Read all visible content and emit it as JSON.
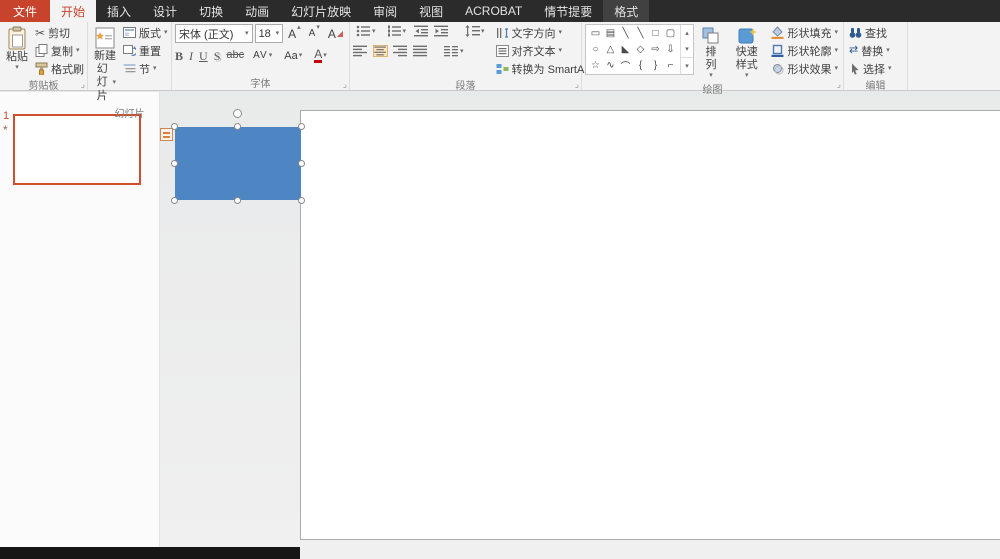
{
  "tabs": {
    "file": "文件",
    "list": [
      "开始",
      "插入",
      "设计",
      "切换",
      "动画",
      "幻灯片放映",
      "审阅",
      "视图",
      "ACROBAT",
      "情节提要",
      "格式"
    ]
  },
  "icons": {
    "caret": "▾",
    "up": "▴",
    "down": "▾",
    "more": "▾",
    "dialog": "⌟",
    "cut": "✂",
    "replace": "⇄"
  },
  "clipboard": {
    "group": "剪贴板",
    "paste": "粘贴",
    "cut": "剪切",
    "copy": "复制",
    "painter": "格式刷"
  },
  "slides": {
    "group": "幻灯片",
    "new_slide_line1": "新建",
    "new_slide_line2": "幻灯片",
    "layout": "版式",
    "reset": "重置",
    "section": "节"
  },
  "font": {
    "group": "字体",
    "name": "宋体 (正文)",
    "size": "18",
    "grow": "A",
    "shrink": "A",
    "clear": "A",
    "bold": "B",
    "italic": "I",
    "underline": "U",
    "shadow": "S",
    "strike": "abc",
    "spacing": "AV",
    "case": "Aa",
    "color": "A"
  },
  "paragraph": {
    "group": "段落",
    "direction": "文字方向",
    "align_text": "对齐文本",
    "smartart": "转换为 SmartArt"
  },
  "drawing": {
    "group": "绘图",
    "arrange": "排列",
    "quick_styles": "快速样式",
    "fill": "形状填充",
    "outline": "形状轮廓",
    "effects": "形状效果",
    "shapes": [
      [
        "▭",
        "▤",
        "╲",
        "╲",
        "□",
        "▢"
      ],
      [
        "○",
        "△",
        "◣",
        "◇",
        "⇨",
        "⇩"
      ],
      [
        "☆",
        "∿",
        "⌒",
        "{",
        "}",
        "⌐"
      ]
    ]
  },
  "editing": {
    "group": "编辑",
    "find": "查找",
    "replace": "替换",
    "select": "选择"
  },
  "slide_panel": {
    "number": "1",
    "star": "*"
  },
  "colors": {
    "accent_red": "#c8432c",
    "shape_blue": "#4e86c3"
  }
}
